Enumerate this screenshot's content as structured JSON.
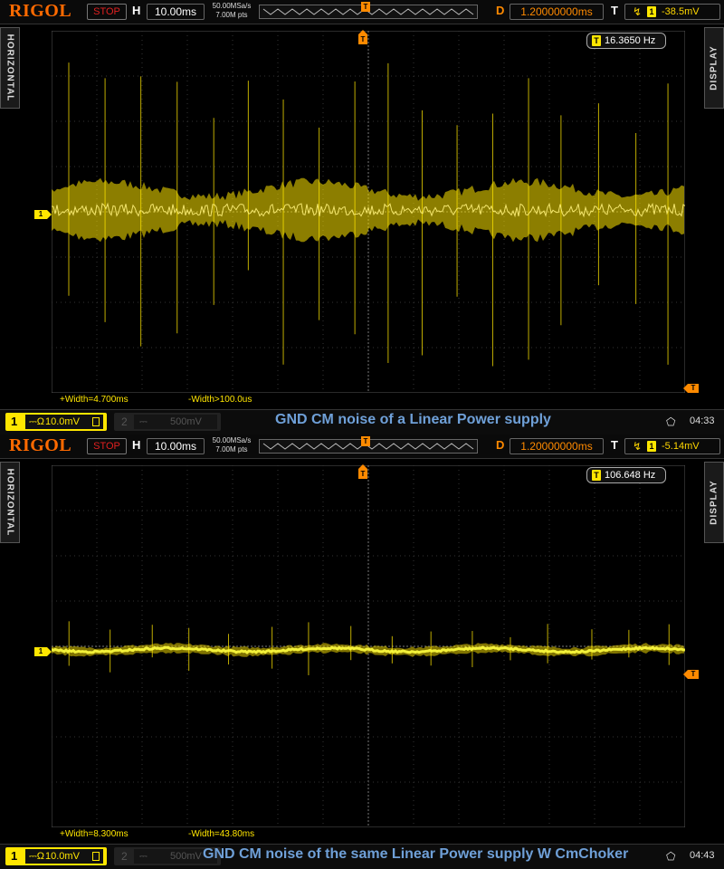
{
  "screens": [
    {
      "logo": "RIGOL",
      "status": "STOP",
      "h_label": "H",
      "timebase": "10.00ms",
      "sample_rate": "50.00MSa/s",
      "mem_depth": "7.00M pts",
      "d_label": "D",
      "delay": "1.20000000ms",
      "t_label": "T",
      "trigger_source": "1",
      "trigger_level": "-38.5mV",
      "left_tab": "HORIZONTAL",
      "right_tab": "DISPLAY",
      "frequency": "16.3650 Hz",
      "pos_width": "+Width=4.700ms",
      "neg_width": "-Width>100.0us",
      "ch1_number": "1",
      "ch1_coupling": "⎓Ω",
      "ch1_scale": "10.0mV",
      "ch2_number": "2",
      "ch2_coupling": "⎓",
      "ch2_scale": "500mV",
      "caption": "GND CM noise of a Linear Power supply",
      "time": "04:33",
      "usb_icon": "usb-icon",
      "trace_color": "#ffe600",
      "noise_band": "wide",
      "spike_count": 18
    },
    {
      "logo": "RIGOL",
      "status": "STOP",
      "h_label": "H",
      "timebase": "10.00ms",
      "sample_rate": "50.00MSa/s",
      "mem_depth": "7.00M pts",
      "d_label": "D",
      "delay": "1.20000000ms",
      "t_label": "T",
      "trigger_source": "1",
      "trigger_level": "-5.14mV",
      "left_tab": "HORIZONTAL",
      "right_tab": "DISPLAY",
      "frequency": "106.648 Hz",
      "pos_width": "+Width=8.300ms",
      "neg_width": "-Width=43.80ms",
      "ch1_number": "1",
      "ch1_coupling": "⎓Ω",
      "ch1_scale": "10.0mV",
      "ch2_number": "2",
      "ch2_coupling": "⎓",
      "ch2_scale": "500mV",
      "caption": "GND CM noise of the same Linear Power supply W CmChoker",
      "time": "04:43",
      "usb_icon": "usb-icon",
      "trace_color": "#ffe600",
      "noise_band": "narrow",
      "spike_count": 16
    }
  ],
  "colors": {
    "logo": "#ff6a00",
    "trace": "#ffe600",
    "delay": "#ff8a00",
    "caption": "#6fa0d8",
    "stop": "#e02020"
  }
}
